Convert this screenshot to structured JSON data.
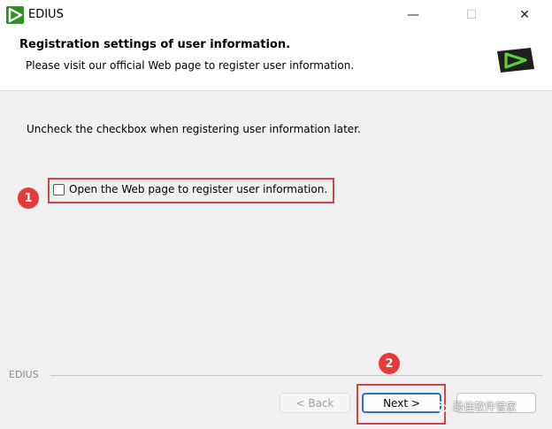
{
  "window": {
    "title": "EDIUS",
    "minimize_glyph": "—",
    "maximize_glyph": "☐",
    "close_glyph": "✕"
  },
  "header": {
    "title": "Registration settings of user information.",
    "subtitle": "Please visit our official Web page to register user information."
  },
  "body": {
    "instruction": "Uncheck the checkbox when registering user information later.",
    "checkbox": {
      "label": "Open the Web page to register user information.",
      "checked": false
    }
  },
  "annotations": {
    "step1": "1",
    "step2": "2",
    "highlight_color": "#d64545",
    "badge_color": "#e53b3b"
  },
  "footer": {
    "group_label": "EDIUS",
    "back_label": "< Back",
    "next_label": "Next >",
    "cancel_label": ""
  },
  "watermark": {
    "text": "最佳软件管家",
    "icon": "wechat-icon"
  },
  "colors": {
    "brand_green": "#3aa52a",
    "focus_blue": "#2b6fd6"
  }
}
